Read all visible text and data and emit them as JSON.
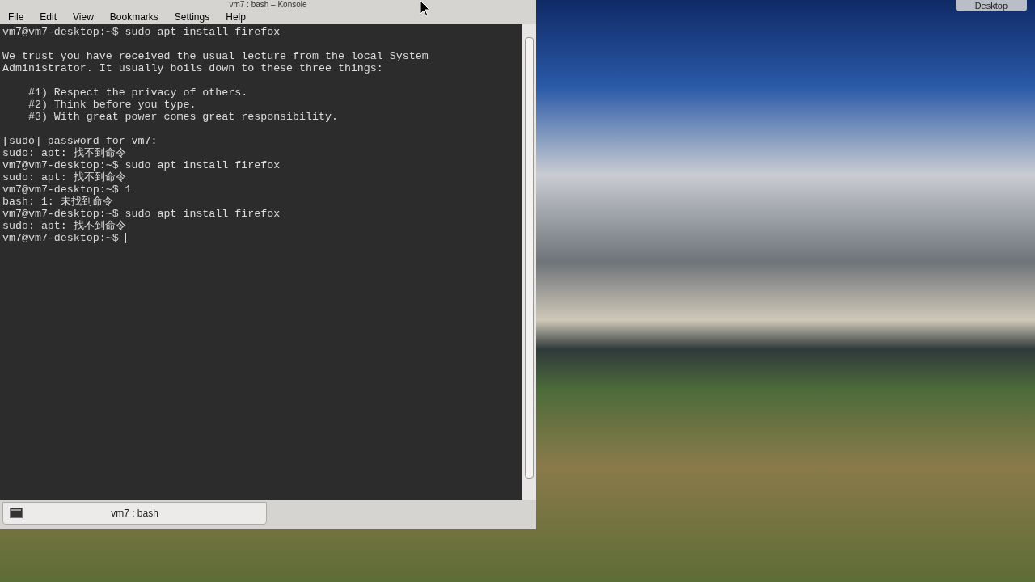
{
  "window": {
    "title": "vm7 : bash – Konsole"
  },
  "menu": [
    "File",
    "Edit",
    "View",
    "Bookmarks",
    "Settings",
    "Help"
  ],
  "terminal": {
    "blocks": [
      [
        "vm7@vm7-desktop:~$ sudo apt install firefox"
      ],
      [
        "We trust you have received the usual lecture from the local System",
        "Administrator. It usually boils down to these three things:"
      ],
      [
        "    #1) Respect the privacy of others.",
        "    #2) Think before you type.",
        "    #3) With great power comes great responsibility."
      ],
      [
        "[sudo] password for vm7:",
        "sudo: apt: 找不到命令",
        "vm7@vm7-desktop:~$ sudo apt install firefox",
        "sudo: apt: 找不到命令",
        "vm7@vm7-desktop:~$ 1",
        "bash: 1: 未找到命令",
        "vm7@vm7-desktop:~$ sudo apt install firefox",
        "sudo: apt: 找不到命令",
        "vm7@vm7-desktop:~$ "
      ]
    ]
  },
  "tabs": [
    {
      "label": "vm7 : bash",
      "selected": true
    }
  ],
  "desktop": {
    "button": "Desktop"
  }
}
